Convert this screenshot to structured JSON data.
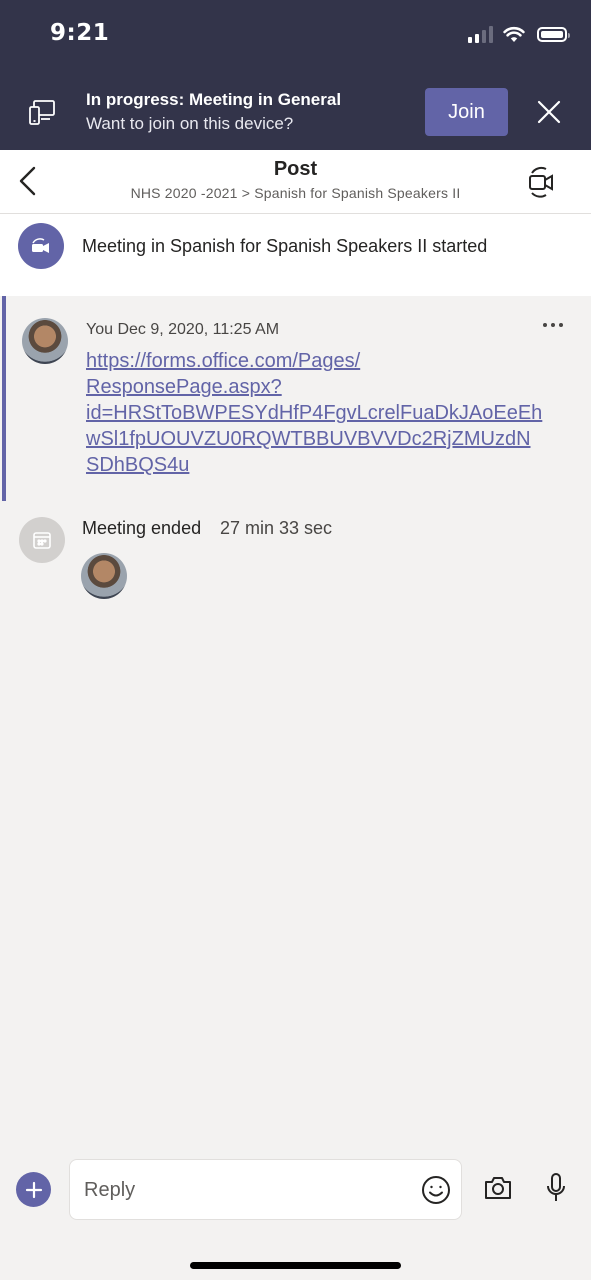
{
  "status_bar": {
    "time": "9:21"
  },
  "banner": {
    "title": "In progress: Meeting in General",
    "subtitle": "Want to join on this device?",
    "join_label": "Join"
  },
  "header": {
    "title": "Post",
    "breadcrumb": "NHS 2020 -2021 > Spanish for Spanish Speakers II"
  },
  "meeting_started": {
    "text": "Meeting in Spanish for Spanish Speakers II started"
  },
  "message": {
    "author_time": "You Dec 9, 2020, 11:25 AM",
    "more_label": "•••",
    "link_lines": [
      "https://forms.office.com/Pages/",
      "ResponsePage.aspx?",
      "id=HRStToBWPESYdHfP4FgvLcrelFuaDkJAoEeEh",
      "wSl1fpUOUVZU0RQWTBBUVBVVDc2RjZMUzdN",
      "SDhBQS4u"
    ]
  },
  "meeting_ended": {
    "label": "Meeting ended",
    "duration": "27 min 33 sec"
  },
  "composer": {
    "placeholder": "Reply"
  },
  "colors": {
    "brand": "#6264a7",
    "banner_bg": "#33344a",
    "background": "#f3f2f1"
  }
}
